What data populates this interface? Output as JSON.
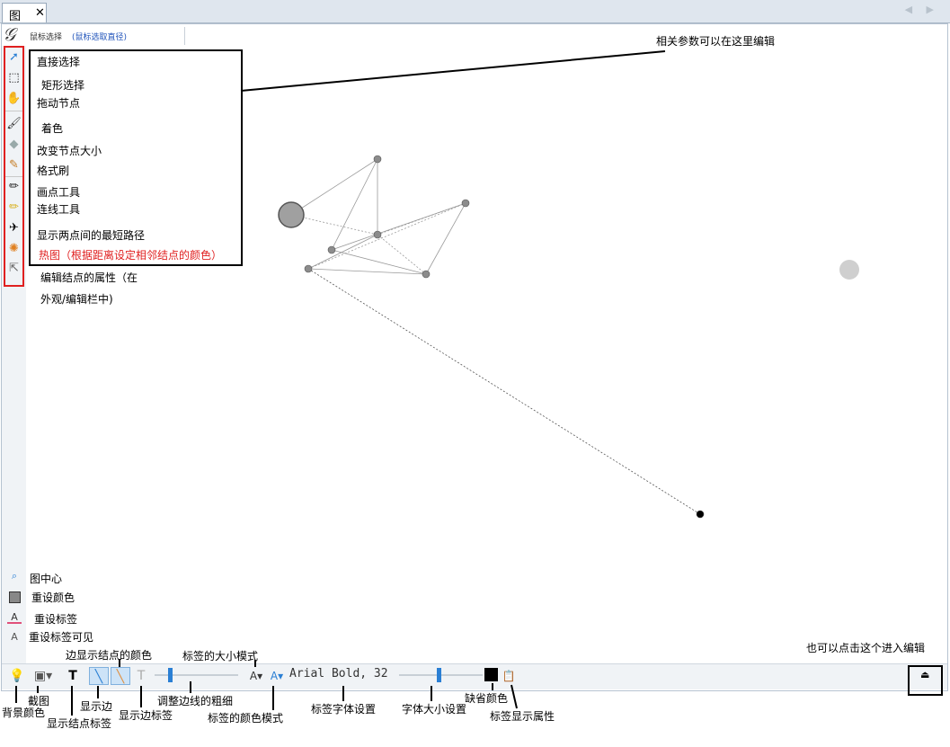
{
  "tab": {
    "label": "图",
    "close": "✕"
  },
  "toolbar_top": {
    "mode": "鼠标选择",
    "hint": "(鼠标选取直径)"
  },
  "tool_annotations": {
    "direct_select": "直接选择",
    "rect_select": "矩形选择",
    "drag_node": "拖动节点",
    "paint": "着色",
    "resize_node": "改变节点大小",
    "format_brush": "格式刷",
    "point_tool": "画点工具",
    "edge_tool": "连线工具",
    "shortest_path": "显示两点间的最短路径",
    "heatmap": "热图（根据距离设定相邻结点的颜色）",
    "edit_props_1": "编辑结点的属性（在",
    "edit_props_2": "外观/编辑栏中)"
  },
  "callout_top_right": "相关参数可以在这里编辑",
  "bottom_left_commands": {
    "center": "图中心",
    "reset_color": "重设颜色",
    "reset_label": "重设标签",
    "reset_label_visible": "重设标签可见"
  },
  "bottom_toolbar": {
    "font_label": "Arial Bold, 32",
    "default_color": "#000000"
  },
  "callout_bottom_right": "也可以点击这个进入编辑",
  "bottom_annotations": {
    "bg_color": "背景颜色",
    "screenshot": "截图",
    "show_node_labels": "显示结点标签",
    "show_edges": "显示边",
    "edge_shows_node_color": "边显示结点的颜色",
    "show_edge_labels": "显示边标签",
    "edge_thickness": "调整边线的粗细",
    "label_size_mode": "标签的大小模式",
    "label_color_mode": "标签的颜色模式",
    "label_font": "标签字体设置",
    "font_size": "字体大小设置",
    "default_color": "缺省颜色",
    "label_display_props": "标签显示属性"
  },
  "colors": {
    "highlight": "#e02020",
    "accent": "#2a7fd4",
    "node": "#8c8c8c",
    "big_node": "#a0a0a0",
    "faded_node": "#cfcfcf"
  }
}
